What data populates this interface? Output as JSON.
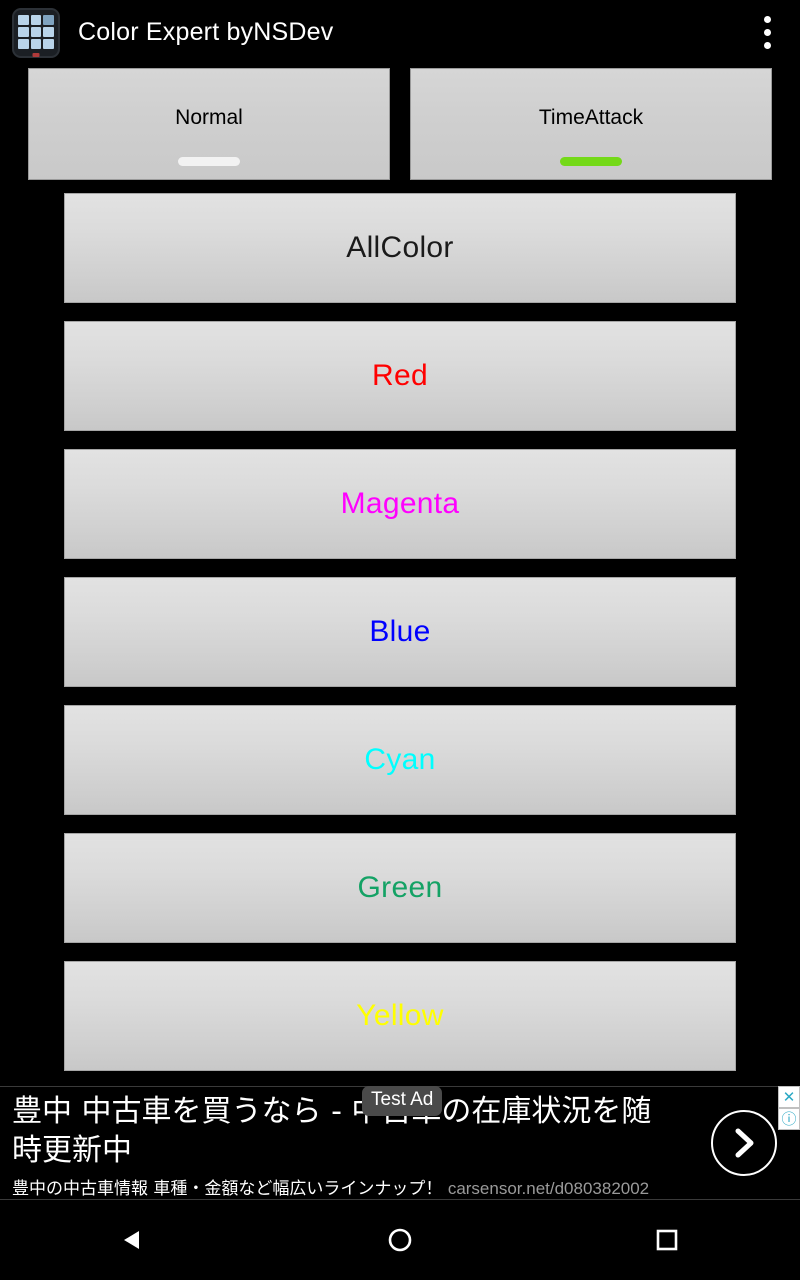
{
  "appbar": {
    "title": "Color Expert byNSDev",
    "icon_name": "app-grid-icon",
    "overflow_name": "more-options"
  },
  "tabs": [
    {
      "label": "Normal",
      "indicator_color": "#f2f2f2",
      "active": false
    },
    {
      "label": "TimeAttack",
      "indicator_color": "#74d918",
      "active": true
    }
  ],
  "buttons": [
    {
      "label": "AllColor",
      "color": "#1a1a1a"
    },
    {
      "label": "Red",
      "color": "#ff0000"
    },
    {
      "label": "Magenta",
      "color": "#ff00ff"
    },
    {
      "label": "Blue",
      "color": "#0000ff"
    },
    {
      "label": "Cyan",
      "color": "#00ffff"
    },
    {
      "label": "Green",
      "color": "#14a265"
    },
    {
      "label": "Yellow",
      "color": "#ffff00"
    }
  ],
  "ad": {
    "badge": "Test Ad",
    "headline": "豊中 中古車を買うなら - 中古車の在庫状況を随時更新中",
    "subtext": "豊中の中古車情報 車種・金額など幅広いラインナップ！",
    "url": "carsensor.net/d080382002",
    "close_glyph": "✕",
    "info_glyph": "ⓘ",
    "arrow_glyph": "❯"
  },
  "navbar": {
    "back": "back-button",
    "home": "home-button",
    "recents": "recents-button"
  }
}
